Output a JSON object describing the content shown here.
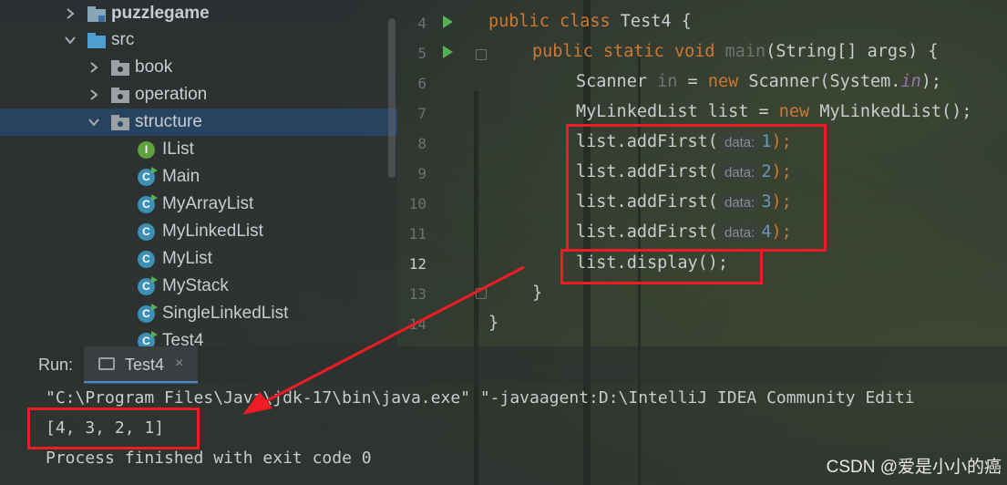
{
  "project_tree": {
    "items": [
      {
        "label": "puzzlegame",
        "type": "module"
      },
      {
        "label": "src",
        "type": "source-folder"
      },
      {
        "label": "book",
        "type": "package"
      },
      {
        "label": "operation",
        "type": "package"
      },
      {
        "label": "structure",
        "type": "package"
      },
      {
        "label": "IList",
        "type": "interface"
      },
      {
        "label": "Main",
        "type": "class"
      },
      {
        "label": "MyArrayList",
        "type": "class"
      },
      {
        "label": "MyLinkedList",
        "type": "class"
      },
      {
        "label": "MyList",
        "type": "class"
      },
      {
        "label": "MyStack",
        "type": "class"
      },
      {
        "label": "SingleLinkedList",
        "type": "class"
      },
      {
        "label": "Test4",
        "type": "class"
      }
    ],
    "badge_class": "C",
    "badge_interface": "I"
  },
  "editor": {
    "line_numbers": [
      "4",
      "5",
      "6",
      "7",
      "8",
      "9",
      "10",
      "11",
      "12",
      "13",
      "14"
    ],
    "line4": {
      "kw1": "public ",
      "kw2": "class ",
      "rest": "Test4 {"
    },
    "line5": {
      "kw1": "public ",
      "kw2": "static ",
      "kw3": "void ",
      "name": "main",
      "rest": "(String[] args) {"
    },
    "line6": {
      "a": "Scanner ",
      "b": "in",
      "c": " = ",
      "kw": "new ",
      "d": "Scanner(System.",
      "e": "in",
      "f": ");"
    },
    "line7": {
      "a": "MyLinkedList list = ",
      "kw": "new ",
      "b": "MyLinkedList();"
    },
    "add_lines": [
      {
        "call": "list.addFirst(",
        "hint": "data:",
        "value": "1",
        "end": ");"
      },
      {
        "call": "list.addFirst(",
        "hint": "data:",
        "value": "2",
        "end": ");"
      },
      {
        "call": "list.addFirst(",
        "hint": "data:",
        "value": "3",
        "end": ");"
      },
      {
        "call": "list.addFirst(",
        "hint": "data:",
        "value": "4",
        "end": ");"
      }
    ],
    "line12": "list.display();",
    "line13": "}",
    "line14": "}"
  },
  "run_panel": {
    "label": "Run:",
    "tab": "Test4",
    "close": "×",
    "output_lines": [
      "\"C:\\Program Files\\Java\\jdk-17\\bin\\java.exe\" \"-javaagent:D:\\IntelliJ IDEA Community Editi",
      "[4, 3, 2, 1]",
      "Process finished with exit code 0"
    ]
  },
  "watermark": "CSDN @爱是小小的癌",
  "colors": {
    "highlight_box": "#ee1c24",
    "selection": "#264669",
    "keyword": "#cc7832",
    "number": "#6897bb"
  }
}
